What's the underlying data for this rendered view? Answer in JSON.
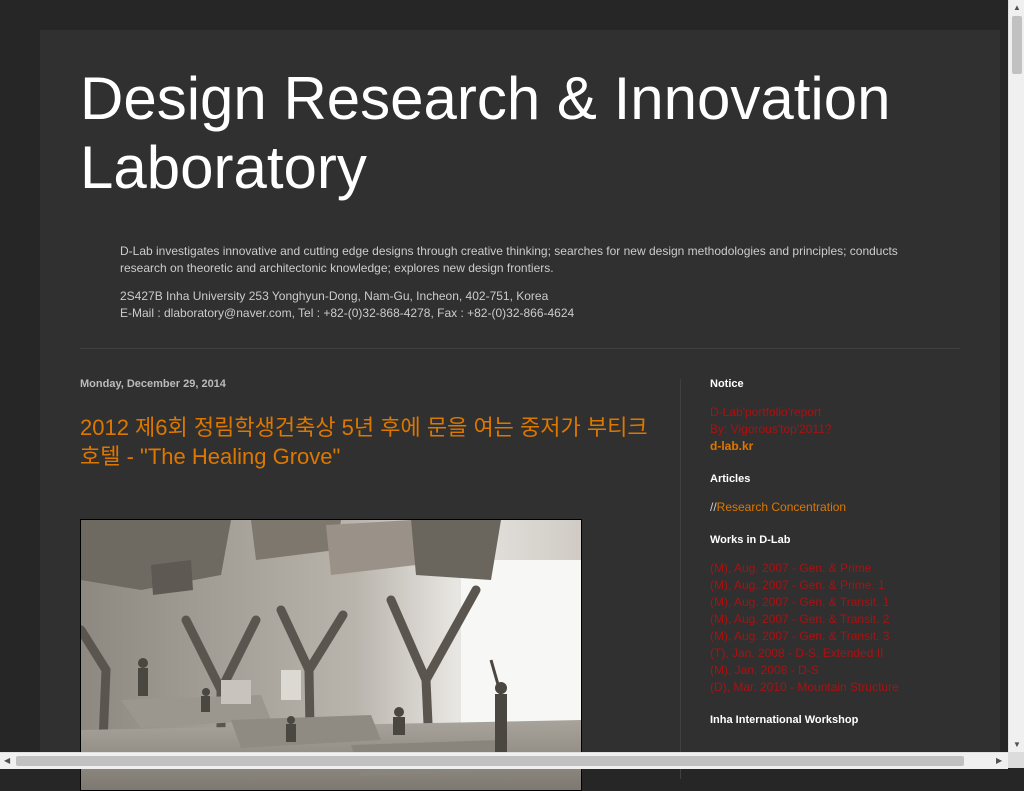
{
  "blog": {
    "title": "Design Research & Innovation Laboratory",
    "description": "D-Lab investigates innovative and cutting edge designs through creative thinking; searches for new design methodologies and principles; conducts research on theoretic and architectonic knowledge; explores new design frontiers.",
    "address": "2S427B Inha University 253 Yonghyun-Dong, Nam-Gu, Incheon, 402-751, Korea",
    "contact": "E-Mail : dlaboratory@naver.com, Tel : +82-(0)32-868-4278, Fax : +82-(0)32-866-4624"
  },
  "post": {
    "date": "Monday, December 29, 2014",
    "title": "2012 제6회 정림학생건축상 5년 후에 문을 여는 중저가 부티크 호텔 - \"The Healing Grove\"",
    "image_alt": "Interior rendering of The Healing Grove"
  },
  "sidebar": {
    "notice": {
      "title": "Notice",
      "links": [
        "D-Lab'portfolio'report",
        "By: Vigorous'top'2011?",
        "d-lab.kr"
      ]
    },
    "articles": {
      "title": "Articles",
      "prefix": "//",
      "link": "Research Concentration"
    },
    "works": {
      "title": "Works in D-Lab",
      "links": [
        "(M), Aug. 2007 - Gen. & Prime",
        "(M), Aug. 2007 - Gen. & Prime. 1",
        "(M), Aug. 2007 - Gen. & Transit. 1",
        "(M), Aug. 2007 - Gen. & Transit. 2",
        "(M), Aug. 2007 - Gen. & Transit. 3",
        "(T), Jan. 2008 - D-S. Extended II",
        "(M), Jan. 2008 - D-S",
        "(D), Mar. 2010 - Mountain Structure"
      ]
    },
    "workshop": {
      "title": "Inha International Workshop"
    }
  },
  "colors": {
    "page_bg": "#262626",
    "content_bg": "#303030",
    "title": "#ffffff",
    "link_orange": "#dd7700",
    "link_red": "#aa1111"
  }
}
